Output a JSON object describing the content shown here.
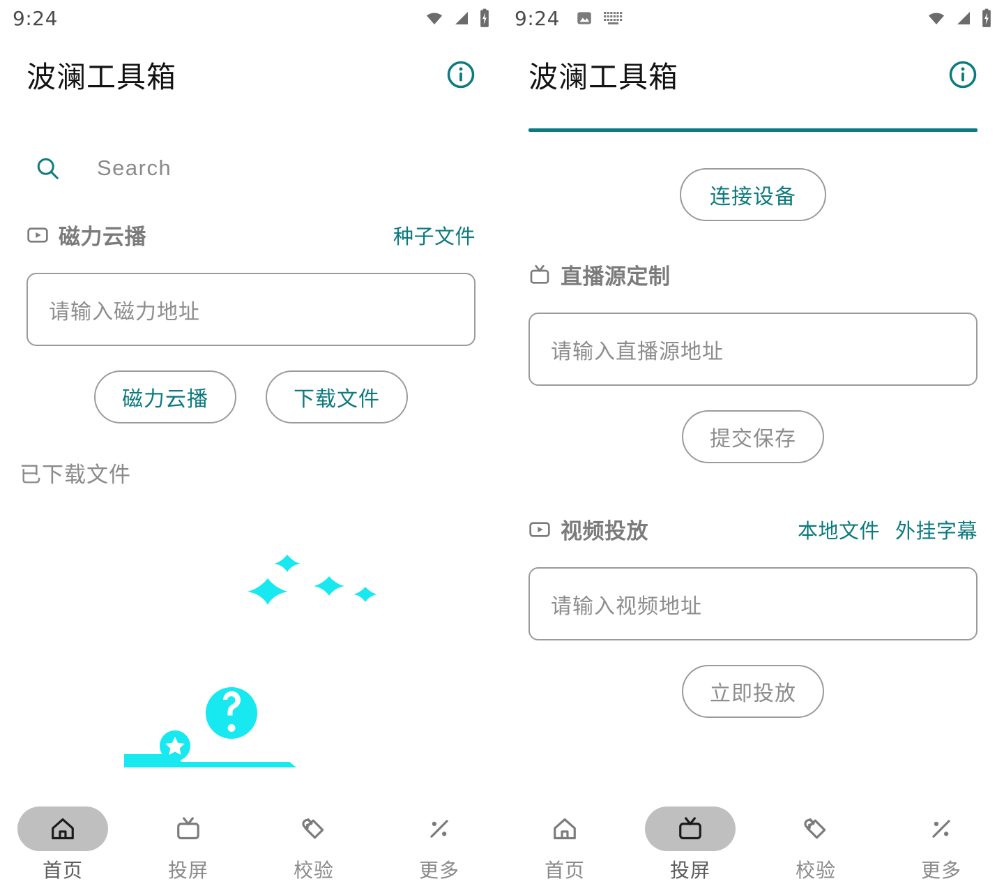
{
  "theme": {
    "accent_teal": "#0d7a7f",
    "illustration_cyan": "#18e8f0",
    "muted_gray": "#8a8a8a",
    "border_gray": "#9b9b9b",
    "active_pill_gray": "#bfbfbf"
  },
  "left_screen": {
    "status_bar": {
      "time": "9:24",
      "left_icons": [],
      "right_icons": [
        "wifi-icon",
        "signal-icon",
        "battery-charging-icon"
      ]
    },
    "app_bar": {
      "title": "波澜工具箱",
      "info_icon": "info-circle-icon"
    },
    "search": {
      "icon": "search-icon",
      "placeholder": "Search",
      "value": ""
    },
    "magnet_section": {
      "icon": "video-play-icon",
      "title": "磁力云播",
      "links": [
        "种子文件"
      ],
      "input_placeholder": "请输入磁力地址",
      "input_value": "",
      "buttons": [
        "磁力云播",
        "下载文件"
      ]
    },
    "downloaded": {
      "label": "已下载文件",
      "empty_illustration": "empty-state-question-illustration"
    },
    "bottom_nav": {
      "active_index": 0,
      "items": [
        {
          "label": "首页",
          "icon": "home-icon"
        },
        {
          "label": "投屏",
          "icon": "tv-icon"
        },
        {
          "label": "校验",
          "icon": "tag-refresh-icon"
        },
        {
          "label": "更多",
          "icon": "percent-icon"
        }
      ]
    }
  },
  "right_screen": {
    "status_bar": {
      "time": "9:24",
      "left_icons": [
        "image-icon",
        "keyboard-icon"
      ],
      "right_icons": [
        "wifi-icon",
        "signal-icon",
        "battery-charging-icon"
      ]
    },
    "app_bar": {
      "title": "波澜工具箱",
      "info_icon": "info-circle-icon",
      "has_teal_divider": true
    },
    "connect": {
      "button_label": "连接设备"
    },
    "live_source_section": {
      "icon": "tv-icon",
      "title": "直播源定制",
      "links": [],
      "input_placeholder": "请输入直播源地址",
      "input_value": "",
      "buttons": [
        "提交保存"
      ]
    },
    "video_cast_section": {
      "icon": "video-play-icon",
      "title": "视频投放",
      "links": [
        "本地文件",
        "外挂字幕"
      ],
      "input_placeholder": "请输入视频地址",
      "input_value": "",
      "buttons": [
        "立即投放"
      ]
    },
    "bottom_nav": {
      "active_index": 1,
      "items": [
        {
          "label": "首页",
          "icon": "home-icon"
        },
        {
          "label": "投屏",
          "icon": "tv-icon"
        },
        {
          "label": "校验",
          "icon": "tag-refresh-icon"
        },
        {
          "label": "更多",
          "icon": "percent-icon"
        }
      ]
    }
  }
}
